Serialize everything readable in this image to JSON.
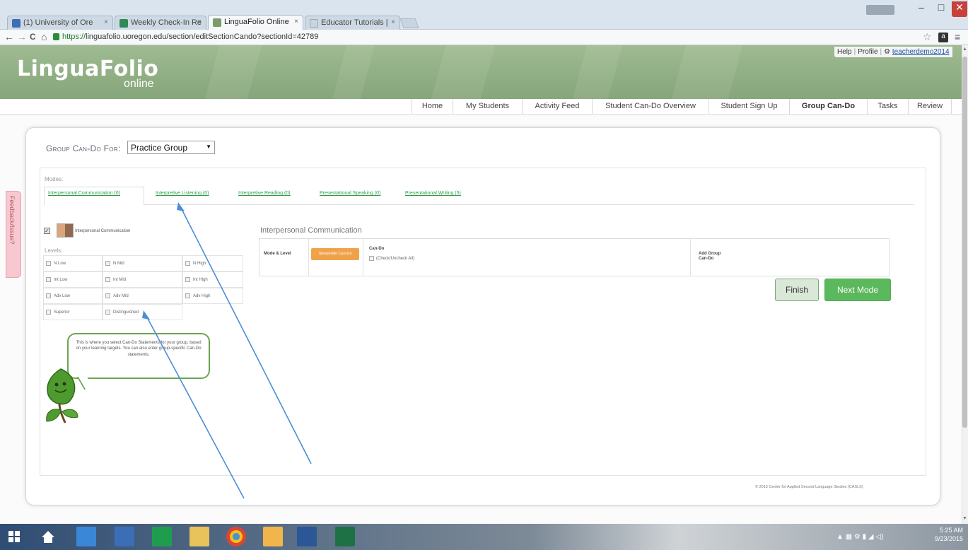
{
  "browser": {
    "tabs": [
      {
        "title": "(1) University of Ore",
        "icon_color": "#3b6fb6"
      },
      {
        "title": "Weekly Check-In Re",
        "icon_color": "#2e8b57"
      },
      {
        "title": "LinguaFolio Online",
        "icon_color": "#7a9c6b"
      },
      {
        "title": "Educator Tutorials |",
        "icon_color": "#9aa"
      }
    ],
    "tab_close": "×",
    "url_https": "https://",
    "url_rest": "linguafolio.uoregon.edu/section/editSectionCando?sectionId=42789",
    "back": "←",
    "forward": "→",
    "reload": "C",
    "home": "⌂",
    "star": "☆",
    "ext_label": "a",
    "menu": "≡",
    "minimize": "–",
    "maximize": "□",
    "close": "✕"
  },
  "site": {
    "logo": "LinguaFolio",
    "logo_sub": "online",
    "user_links": {
      "help": "Help",
      "profile": "Profile",
      "username": "teacherdemo2014"
    },
    "nav": [
      "Home",
      "My Students",
      "Activity Feed",
      "Student Can-Do Overview",
      "Student Sign Up",
      "Group Can-Do",
      "Tasks",
      "Review"
    ],
    "nav_active": "Group Can-Do"
  },
  "page": {
    "group_label": "Group Can-Do For:",
    "group_selected": "Practice Group",
    "modes_label": "Modes:",
    "modes": [
      "Interpersonal Communication (0)",
      "Interpretive Listening (0)",
      "Interpretive Reading (0)",
      "Presentational Speaking (0)",
      "Presentational Writing (5)"
    ],
    "ic_label": "Interpersonal Communication",
    "levels_label": "Levels:",
    "levels": [
      "N Low",
      "N Mid",
      "N High",
      "Int Low",
      "Int Mid",
      "Int High",
      "Adv Low",
      "Adv Mid",
      "Adv High",
      "Superior",
      "Distinguished"
    ],
    "section_title": "Interpersonal Communication",
    "table": {
      "mode_level": "Mode & Level",
      "showhide": "Show/Hide Can-Do",
      "cando": "Can-Do",
      "check_all": "(Check/Uncheck All)",
      "add_group_1": "Add Group",
      "add_group_2": "Can-Do"
    },
    "finish": "Finish",
    "next_mode": "Next Mode",
    "tip": "This is where you select Can-Do Statements for your group, based on your learning targets. You can also enter group-specific Can-Do statements.",
    "footer": "© 2015 Center for Applied Second Language Studies (CASLS)",
    "feedback": "Feedback/Issue?"
  },
  "taskbar": {
    "time": "5:25 AM",
    "date": "9/23/2015"
  },
  "colors": {
    "header_green": "#8fae83",
    "link_green": "#2e9b48",
    "button_green": "#5cb85c",
    "button_orange": "#f0a24b",
    "annotation_blue": "#4a8fd6"
  }
}
